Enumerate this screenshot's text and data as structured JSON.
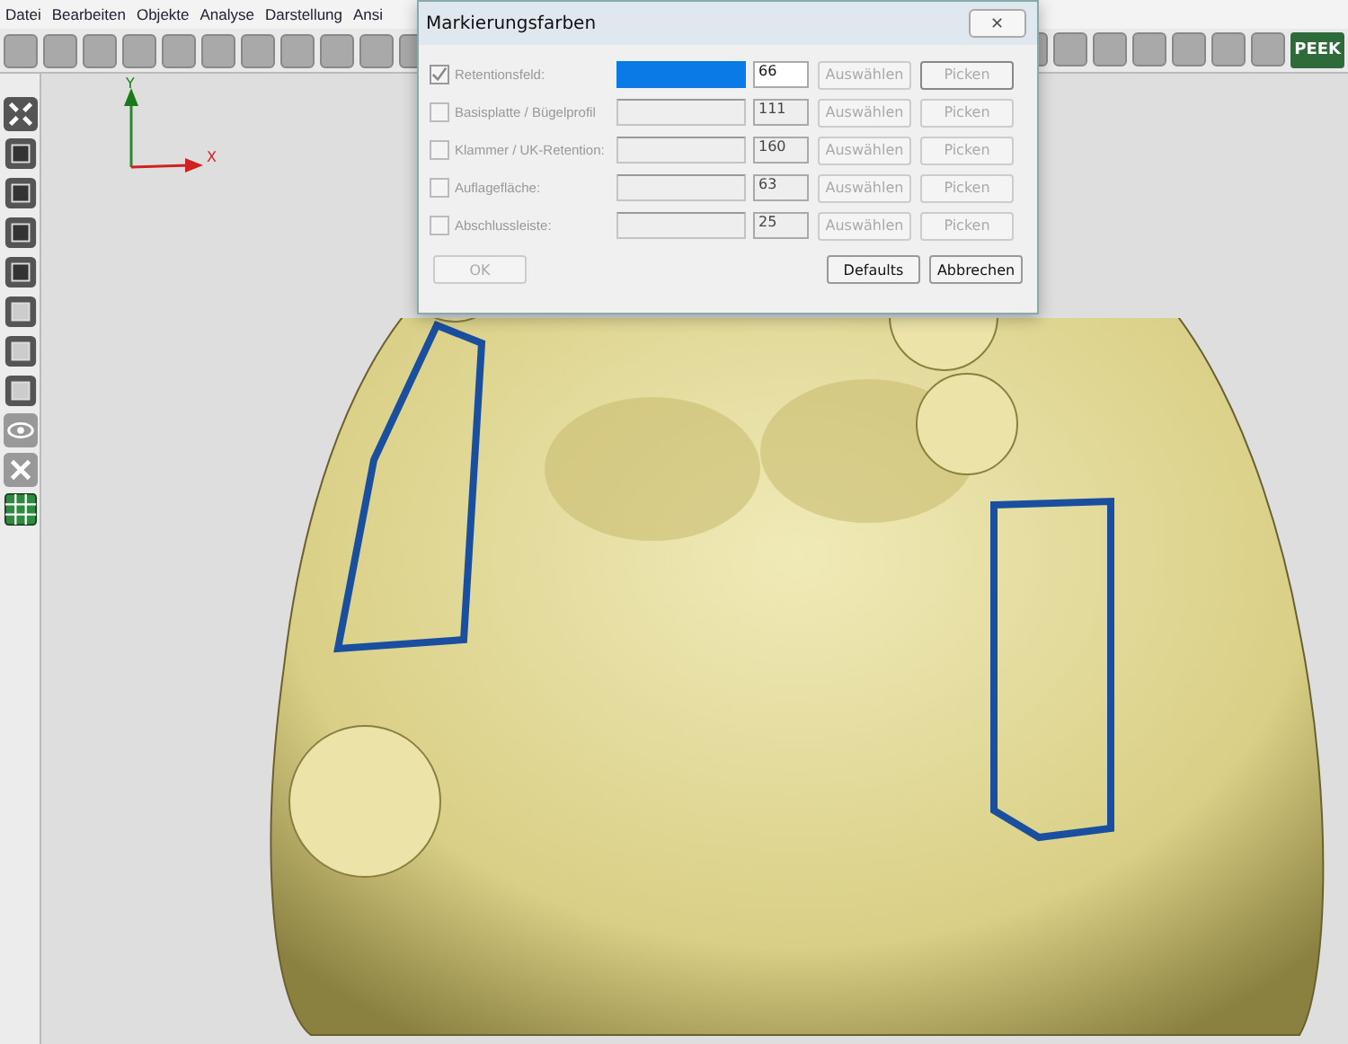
{
  "menu": [
    "Datei",
    "Bearbeiten",
    "Objekte",
    "Analyse",
    "Darstellung",
    "Ansi"
  ],
  "toolbar": {
    "badge": "PEEK"
  },
  "axes": {
    "y_label": "Y",
    "x_label": "X"
  },
  "dialog": {
    "title": "Markierungsfarben",
    "close": "✕",
    "rows": [
      {
        "label": "Retentionsfeld:",
        "checked": true,
        "color": "#0a7ae6",
        "value": "66",
        "select": "Auswählen",
        "pick": "Picken"
      },
      {
        "label": "Basisplatte / Bügelprofil",
        "checked": false,
        "value": "111",
        "select": "Auswählen",
        "pick": "Picken"
      },
      {
        "label": "Klammer / UK-Retention:",
        "checked": false,
        "value": "160",
        "select": "Auswählen",
        "pick": "Picken"
      },
      {
        "label": "Auflagefläche:",
        "checked": false,
        "value": "63",
        "select": "Auswählen",
        "pick": "Picken"
      },
      {
        "label": "Abschlussleiste:",
        "checked": false,
        "value": "25",
        "select": "Auswählen",
        "pick": "Picken"
      }
    ],
    "buttons": {
      "ok": "OK",
      "defaults": "Defaults",
      "cancel": "Abbrechen"
    }
  }
}
